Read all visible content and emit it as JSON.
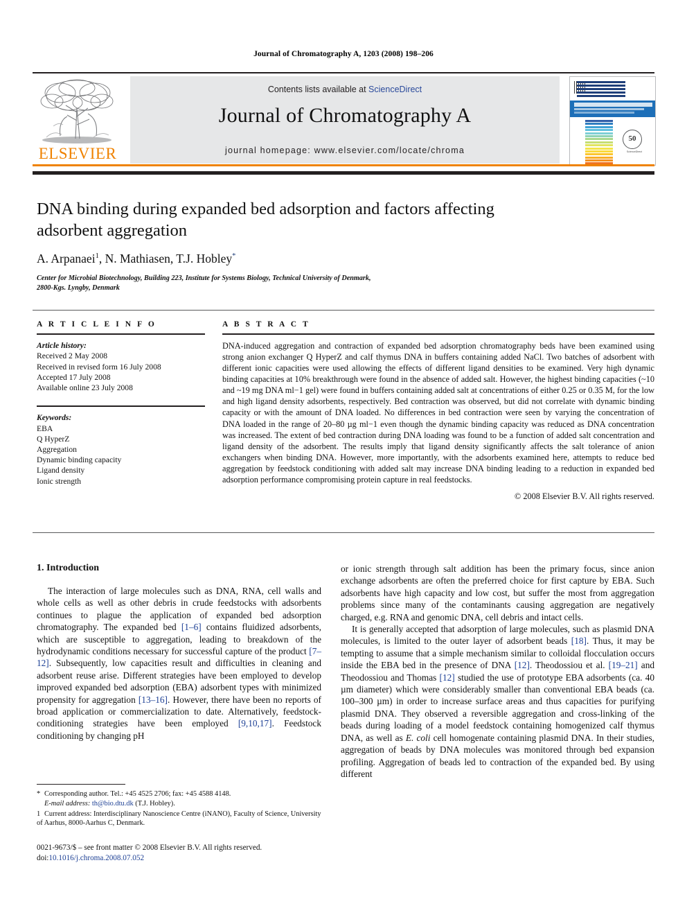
{
  "running_head": "Journal of Chromatography A, 1203 (2008) 198–206",
  "header": {
    "publisher_name": "ELSEVIER",
    "contents_prefix": "Contents lists available at ",
    "sciencedirect": "ScienceDirect",
    "journal_title": "Journal of Chromatography A",
    "homepage": "journal homepage: www.elsevier.com/locate/chroma",
    "cover": {
      "journal_name": "JOURNAL OF CHROMATOGRAPHY A",
      "seal_number": "50",
      "seal_sub": "YEARS",
      "footmark_line1": "Available online at",
      "footmark_line2": "ScienceDirect",
      "spectrum_colors": [
        "#2f5ea8",
        "#2f7fc0",
        "#3fa3d6",
        "#5fc0de",
        "#7ecfd6",
        "#8fd3b6",
        "#a9d88f",
        "#c6de74",
        "#e1e45f",
        "#f3e44a",
        "#fada3a",
        "#fcc62e",
        "#f9ad26",
        "#f4901f",
        "#ef7320",
        "#e85822",
        "#de3f23",
        "#cf2b22"
      ],
      "accent_blue": "#1d6fb8"
    },
    "accent_orange": "#ef8200",
    "link_blue": "#2b4a9b"
  },
  "title_block": {
    "title": "DNA binding during expanded bed adsorption and factors affecting adsorbent aggregation",
    "authors_parts": [
      {
        "text": "A. Arpanaei",
        "sup": "1"
      },
      {
        "text": ", N. Mathiasen, T.J. Hobley",
        "sup": "*"
      }
    ],
    "authors_plain": "A. Arpanaei1, N. Mathiasen, T.J. Hobley*",
    "affiliation_line1": "Center for Microbial Biotechnology, Building 223, Institute for Systems Biology, Technical University of Denmark,",
    "affiliation_line2": "2800-Kgs. Lyngby, Denmark"
  },
  "article_info": {
    "heading": "A R T I C L E   I N F O",
    "history_label": "Article history:",
    "history": [
      "Received 2 May 2008",
      "Received in revised form 16 July 2008",
      "Accepted 17 July 2008",
      "Available online 23 July 2008"
    ],
    "keywords_label": "Keywords:",
    "keywords": [
      "EBA",
      "Q HyperZ",
      "Aggregation",
      "Dynamic binding capacity",
      "Ligand density",
      "Ionic strength"
    ]
  },
  "abstract": {
    "heading": "A B S T R A C T",
    "text": "DNA-induced aggregation and contraction of expanded bed adsorption chromatography beds have been examined using strong anion exchanger Q HyperZ and calf thymus DNA in buffers containing added NaCl. Two batches of adsorbent with different ionic capacities were used allowing the effects of different ligand densities to be examined. Very high dynamic binding capacities at 10% breakthrough were found in the absence of added salt. However, the highest binding capacities (~10 and ~19 mg DNA ml−1 gel) were found in buffers containing added salt at concentrations of either 0.25 or 0.35 M, for the low and high ligand density adsorbents, respectively. Bed contraction was observed, but did not correlate with dynamic binding capacity or with the amount of DNA loaded. No differences in bed contraction were seen by varying the concentration of DNA loaded in the range of 20–80 µg ml−1 even though the dynamic binding capacity was reduced as DNA concentration was increased. The extent of bed contraction during DNA loading was found to be a function of added salt concentration and ligand density of the adsorbent. The results imply that ligand density significantly affects the salt tolerance of anion exchangers when binding DNA. However, more importantly, with the adsorbents examined here, attempts to reduce bed aggregation by feedstock conditioning with added salt may increase DNA binding leading to a reduction in expanded bed adsorption performance compromising protein capture in real feedstocks.",
    "copyright": "© 2008 Elsevier B.V. All rights reserved."
  },
  "body": {
    "section_heading": "1. Introduction",
    "left_paragraph_1_a": "The interaction of large molecules such as DNA, RNA, cell walls and whole cells as well as other debris in crude feedstocks with adsorbents continues to plague the application of expanded bed adsorption chromatography. The expanded bed ",
    "ref_1_6": "[1–6]",
    "left_paragraph_1_b": " contains fluidized adsorbents, which are susceptible to aggregation, leading to breakdown of the hydrodynamic conditions necessary for successful capture of the product ",
    "ref_7_12": "[7–12]",
    "left_paragraph_1_c": ". Subsequently, low capacities result and difficulties in cleaning and adsorbent reuse arise. Different strategies have been employed to develop improved expanded bed adsorption (EBA) adsorbent types with minimized propensity for aggregation ",
    "ref_13_16": "[13–16]",
    "left_paragraph_1_d": ". However, there have been no reports of broad application or commercialization to date. Alternatively, feedstock-conditioning strategies have been employed ",
    "ref_9_10_17": "[9,10,17]",
    "left_paragraph_1_e": ". Feedstock conditioning by changing pH",
    "right_paragraph_1": "or ionic strength through salt addition has been the primary focus, since anion exchange adsorbents are often the preferred choice for first capture by EBA. Such adsorbents have high capacity and low cost, but suffer the most from aggregation problems since many of the contaminants causing aggregation are negatively charged, e.g. RNA and genomic DNA, cell debris and intact cells.",
    "right_paragraph_2_a": "It is generally accepted that adsorption of large molecules, such as plasmid DNA molecules, is limited to the outer layer of adsorbent beads ",
    "ref_18": "[18]",
    "right_paragraph_2_b": ". Thus, it may be tempting to assume that a simple mechanism similar to colloidal flocculation occurs inside the EBA bed in the presence of DNA ",
    "ref_12a": "[12]",
    "right_paragraph_2_c": ". Theodossiou et al. ",
    "ref_19_21": "[19–21]",
    "right_paragraph_2_d": " and Theodossiou and Thomas ",
    "ref_12b": "[12]",
    "right_paragraph_2_e": " studied the use of prototype EBA adsorbents (ca. 40 µm diameter) which were considerably smaller than conventional EBA beads (ca. 100–300 µm) in order to increase surface areas and thus capacities for purifying plasmid DNA. They observed a reversible aggregation and cross-linking of the beads during loading of a model feedstock containing homogenized calf thymus DNA, as well as ",
    "ecoli_italic": "E. coli",
    "right_paragraph_2_f": " cell homogenate containing plasmid DNA. In their studies, aggregation of beads by DNA molecules was monitored through bed expansion profiling. Aggregation of beads led to contraction of the expanded bed. By using different"
  },
  "footnotes": {
    "corresponding_mark": "*",
    "corresponding_text": "Corresponding author. Tel.: +45 4525 2706; fax: +45 4588 4148.",
    "email_label": "E-mail address:",
    "email_address": "th@bio.dtu.dk",
    "email_suffix": " (T.J. Hobley).",
    "current_address_mark": "1",
    "current_address_text": "Current address: Interdisciplinary Nanoscience Centre (iNANO), Faculty of Science, University of Aarhus, 8000-Aarhus C, Denmark."
  },
  "imprint": {
    "line1": "0021-9673/$ – see front matter © 2008 Elsevier B.V. All rights reserved.",
    "doi_label": "doi:",
    "doi_value": "10.1016/j.chroma.2008.07.052"
  }
}
